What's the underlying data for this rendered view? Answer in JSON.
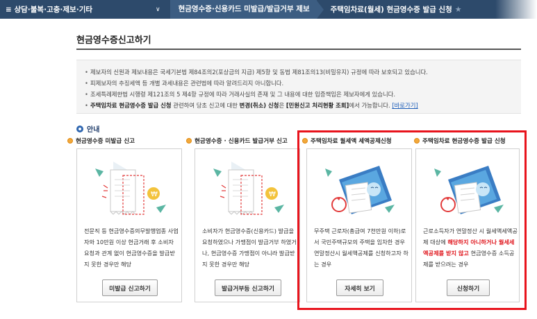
{
  "nav": {
    "menu": "≡ 상담·불복·고충·제보·기타",
    "crumb2": "현금영수증·신용카드 미발급/발급거부 제보",
    "crumb3": "주택임차료(월세) 현금영수증 발급 신청"
  },
  "page": {
    "title": "현금영수증신고하기"
  },
  "notice": {
    "line1": "제보자의 신원과 제보내용은 국세기본법 제84조의2(포상금의 지급) 제5항 및 동법 제81조의13(비밀유지) 규정에 따라 보호되고 있습니다.",
    "line2": "피제보자의 추징세액 등 개별 과세내용은 관련법에 따라 알려드리지 아니합니다.",
    "line3": "조세특례제한법 시행령 제121조의 5 제4항 규정에 따라 거래사실의 존재 및 그 내용에 대한 입증책임은 제보자에게 있습니다.",
    "line4_bold": "주택임차료 현금영수증 발급 신청",
    "line4_mid": " 관련하여 당초 신고에 대한 ",
    "line4_bold2": "변경(취소) 신청",
    "line4_mid2": "은 ",
    "line4_bold3": "[민원신고 처리현황 조회]",
    "line4_end": "에서 가능합니다. ",
    "line4_link": "[바로가기]"
  },
  "guide": {
    "label": "안내"
  },
  "cards": [
    {
      "title": "현금영수증 미발급 신고",
      "desc": "전문직 등 현금영수증의무발행업종 사업자와 10만원 이상 현금거래 후 소비자 요청과 관계 없이 현금영수증을 발급받지 못한 경우만 해당",
      "button": "미발급 신고하기"
    },
    {
      "title": "현금영수증 · 신용카드 발급거부 신고",
      "desc": "소비자가 현금영수증(신용카드) 발급을 요청하였으나 가맹점이 발급거부 하였거나, 현금영수증 가맹점이 아니라 발급받지 못한 경우만 해당",
      "button": "발급거부등 신고하기"
    },
    {
      "title": "주택임차료 월세액 세액공제신청",
      "desc": "무주택 근로자(총급여 7천만원 이하)로서 국민주택규모의 주택을 임차한 경우 연말정산시 월세액공제를 신청하고자 하는 경우",
      "button": "자세히 보기"
    },
    {
      "title": "주택임차료 현금영수증 발급 신청",
      "desc_a": "근로소득자가 연말정산 시 월세액세액공제 대상에 ",
      "desc_red": "해당하지 아니하거나 월세세액공제를 받지 않고",
      "desc_b": " 현금영수증 소득공제를 받으려는 경우",
      "button": "신청하기"
    }
  ],
  "colors": {
    "nav_bg": "#2d4a6b",
    "accent_red": "#e8131c",
    "bullet_orange": "#f2a93b"
  }
}
